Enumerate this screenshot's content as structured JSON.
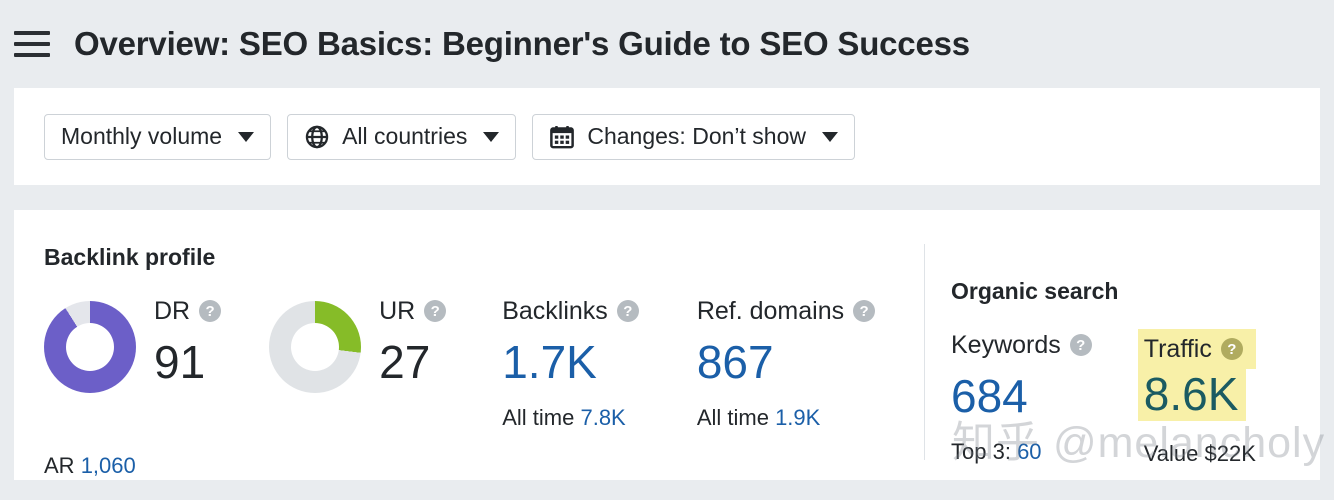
{
  "header": {
    "menu_icon": "hamburger-icon",
    "title": "Overview: SEO Basics: Beginner's Guide to SEO Success"
  },
  "filters": [
    {
      "id": "monthly-volume",
      "label": "Monthly volume",
      "icon": null,
      "caret": true
    },
    {
      "id": "all-countries",
      "label": "All countries",
      "icon": "globe-icon",
      "caret": true
    },
    {
      "id": "changes",
      "label": "Changes: Don’t show",
      "icon": "calendar-icon",
      "caret": true
    }
  ],
  "backlink_profile": {
    "title": "Backlink profile",
    "dr": {
      "label": "DR",
      "value": "91",
      "percent": 91,
      "color": "#6c5fc8",
      "track": "#e4e6eb",
      "help": "?"
    },
    "ur": {
      "label": "UR",
      "value": "27",
      "percent": 27,
      "color": "#86bc28",
      "track": "#e0e3e6",
      "help": "?"
    },
    "ar": {
      "label": "AR",
      "value": "1,060"
    },
    "backlinks": {
      "label": "Backlinks",
      "value": "1.7K",
      "sub_label": "All time",
      "sub_value": "7.8K",
      "help": "?"
    },
    "ref_domains": {
      "label": "Ref. domains",
      "value": "867",
      "sub_label": "All time",
      "sub_value": "1.9K",
      "help": "?"
    }
  },
  "organic_search": {
    "title": "Organic search",
    "keywords": {
      "label": "Keywords",
      "value": "684",
      "sub_label": "Top 3:",
      "sub_value": "60",
      "help": "?"
    },
    "traffic": {
      "label": "Traffic",
      "value": "8.6K",
      "sub_label": "Value",
      "sub_value": "$22K",
      "help": "?",
      "highlight_color": "#f8f0a8"
    }
  },
  "watermark": {
    "text": "知乎 @melancholy"
  },
  "colors": {
    "page_bg": "#e9ecef",
    "card_bg": "#ffffff",
    "value_blue": "#1b5fa8",
    "text_dark": "#23272b",
    "purple": "#6c5fc8",
    "green": "#86bc28",
    "traffic_teal": "#1b5b62"
  }
}
